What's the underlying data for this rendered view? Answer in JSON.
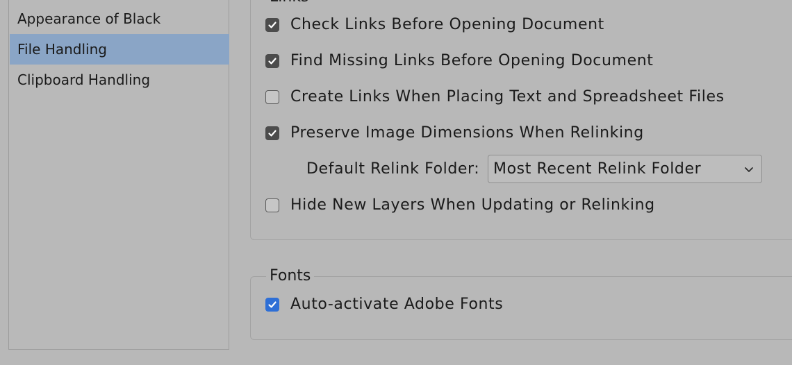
{
  "sidebar": {
    "items": [
      {
        "label": "Appearance of Black",
        "selected": false
      },
      {
        "label": "File Handling",
        "selected": true
      },
      {
        "label": "Clipboard Handling",
        "selected": false
      }
    ]
  },
  "links_group": {
    "legend": "Links",
    "options": [
      {
        "label": "Check Links Before Opening Document",
        "checked": true
      },
      {
        "label": "Find Missing Links Before Opening Document",
        "checked": true
      },
      {
        "label": "Create Links When Placing Text and Spreadsheet Files",
        "checked": false
      },
      {
        "label": "Preserve Image Dimensions When Relinking",
        "checked": true
      },
      {
        "label": "Hide New Layers When Updating or Relinking",
        "checked": false
      }
    ],
    "relink_folder": {
      "label": "Default Relink Folder:",
      "value": "Most Recent Relink Folder"
    }
  },
  "fonts_group": {
    "legend": "Fonts",
    "options": [
      {
        "label": "Auto-activate Adobe Fonts",
        "checked": true
      }
    ]
  },
  "colors": {
    "selection": "#8aa5c6",
    "accent_checkbox": "#2e6fd6",
    "gray_checkbox": "#4c4c4c",
    "background": "#b8b8b8"
  }
}
